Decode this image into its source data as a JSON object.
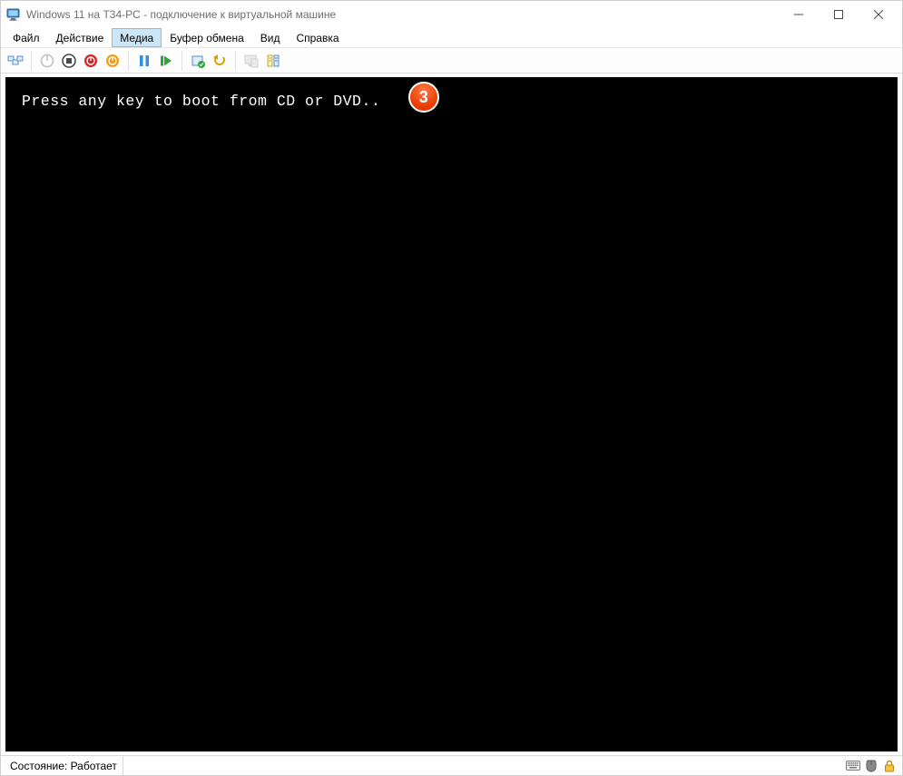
{
  "titlebar": {
    "title": "Windows 11 на T34-PC - подключение к виртуальной машине"
  },
  "menu": {
    "file": "Файл",
    "action": "Действие",
    "media": "Медиа",
    "clipboard": "Буфер обмена",
    "view": "Вид",
    "help": "Справка"
  },
  "toolbar_icons": {
    "ctrlaltdel": "ctrl-alt-del-icon",
    "start": "power-start-icon",
    "stop": "power-stop-icon",
    "turnoff": "power-off-icon",
    "shutdown": "power-shutdown-icon",
    "pause": "pause-icon",
    "reset": "reset-icon",
    "checkpoint": "checkpoint-icon",
    "revert": "revert-icon",
    "enhanced": "enhanced-session-icon",
    "share": "share-icon"
  },
  "console": {
    "boot_message": "Press any key to boot from CD or DVD..",
    "annotation_number": "3"
  },
  "status": {
    "label": "Состояние:",
    "value": "Работает"
  }
}
